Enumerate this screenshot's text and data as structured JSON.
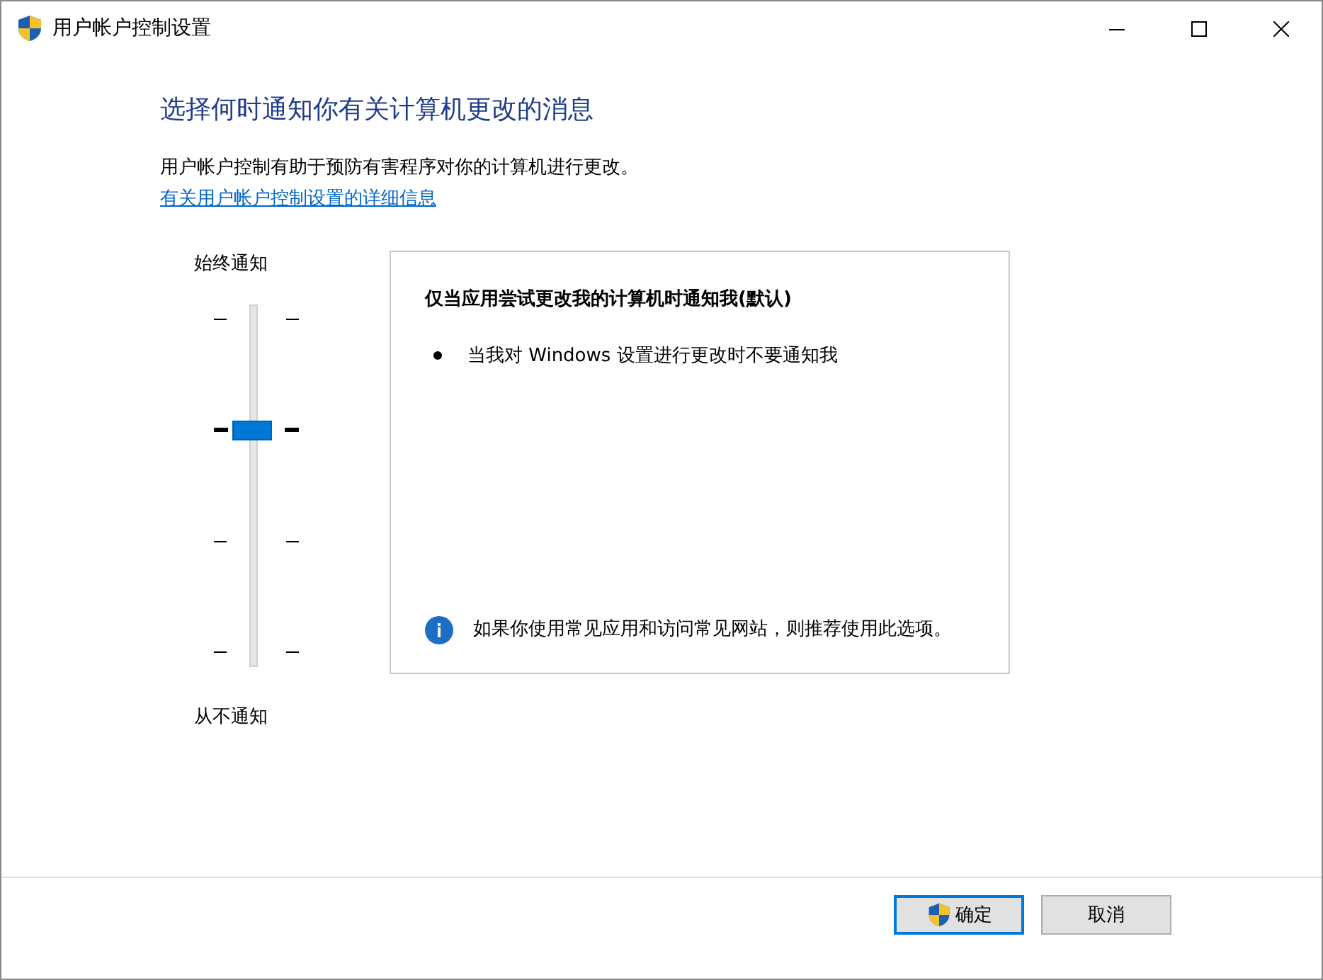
{
  "window": {
    "title": "用户帐户控制设置"
  },
  "heading": "选择何时通知你有关计算机更改的消息",
  "description": "用户帐户控制有助于预防有害程序对你的计算机进行更改。",
  "link": "有关用户帐户控制设置的详细信息",
  "slider": {
    "top_label": "始终通知",
    "bottom_label": "从不通知",
    "positions": [
      {
        "selected": false
      },
      {
        "selected": true
      },
      {
        "selected": false
      },
      {
        "selected": false
      }
    ]
  },
  "panel": {
    "title": "仅当应用尝试更改我的计算机时通知我(默认)",
    "bullets": [
      "当我对 Windows 设置进行更改时不要通知我"
    ],
    "info": "如果你使用常见应用和访问常见网站，则推荐使用此选项。"
  },
  "buttons": [
    {
      "label": "确定",
      "kind": "shield",
      "default": true
    },
    {
      "label": "取消",
      "kind": "plain",
      "default": false
    }
  ]
}
